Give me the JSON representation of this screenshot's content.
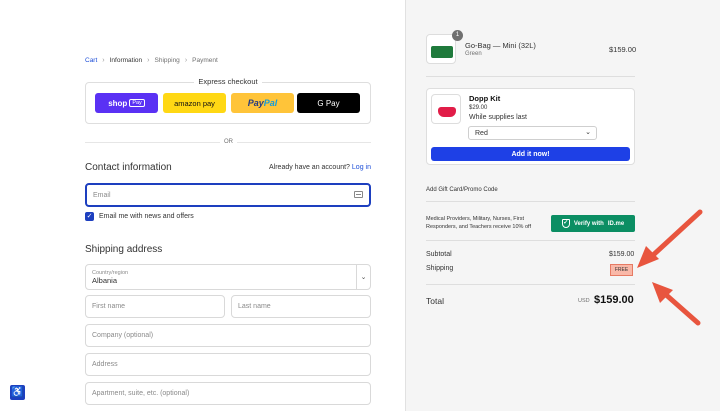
{
  "breadcrumb": [
    "Cart",
    "Information",
    "Shipping",
    "Payment"
  ],
  "express": {
    "title": "Express checkout",
    "shop": "shop",
    "shop_tag": "Pay",
    "amazon": "amazon pay",
    "paypal_a": "Pay",
    "paypal_b": "Pal",
    "gpay": "G Pay"
  },
  "or_text": "OR",
  "contact": {
    "title": "Contact information",
    "account_q": "Already have an account?",
    "login": "Log in",
    "email_placeholder": "Email",
    "newsletter_label": "Email me with news and offers",
    "newsletter_checked": true
  },
  "shipping_address": {
    "title": "Shipping address",
    "country_label": "Country/region",
    "country_value": "Albania",
    "first_name": "First name",
    "last_name": "Last name",
    "company": "Company (optional)",
    "address": "Address",
    "apartment": "Apartment, suite, etc. (optional)"
  },
  "cart_item": {
    "qty": "1",
    "name": "Go-Bag — Mini (32L)",
    "variant": "Green",
    "price": "$159.00"
  },
  "upsell": {
    "name": "Dopp Kit",
    "price": "$29.00",
    "note": "While supplies last",
    "selected_variant": "Red",
    "button": "Add it now!"
  },
  "gift_card": "Add Gift Card/Promo Code",
  "idme": {
    "text": "Medical Providers, Military, Nurses, First Responders, and Teachers receive 10% off",
    "button": "Verify with",
    "brand": "ID.me"
  },
  "summary": {
    "subtotal_label": "Subtotal",
    "subtotal_value": "$159.00",
    "shipping_label": "Shipping",
    "shipping_value": "FREE",
    "total_label": "Total",
    "currency": "USD",
    "total_value": "$159.00"
  },
  "colors": {
    "accent": "#1d3fbf",
    "add_button": "#1e40e6",
    "verify": "#0b8e63",
    "annotation_arrow": "#e8553e"
  }
}
